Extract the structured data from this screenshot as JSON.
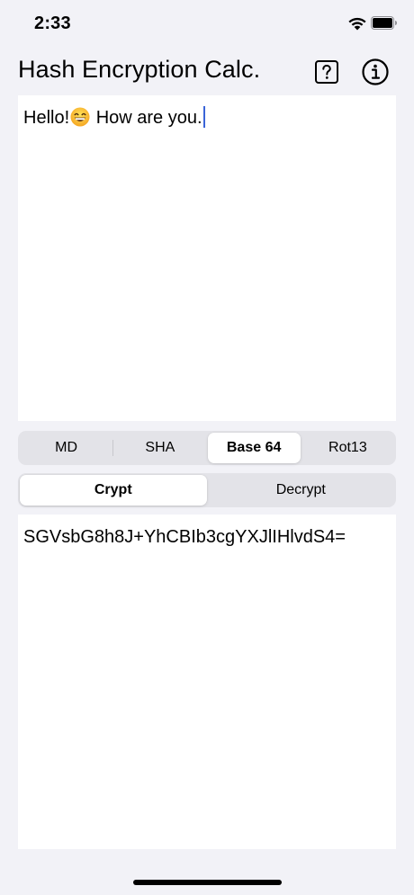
{
  "status_bar": {
    "time": "2:33",
    "icons": [
      "wifi-icon",
      "battery-icon"
    ]
  },
  "nav": {
    "title": "Hash Encryption Calc.",
    "help_icon": "question-square-icon",
    "info_icon": "info-circle-icon"
  },
  "input": {
    "text_before_emoji": "Hello!",
    "emoji": "grinning-face-emoji",
    "text_after_emoji": " How are you."
  },
  "algorithm_tabs": {
    "items": [
      {
        "label": "MD",
        "selected": false
      },
      {
        "label": "SHA",
        "selected": false
      },
      {
        "label": "Base 64",
        "selected": true
      },
      {
        "label": "Rot13",
        "selected": false
      }
    ]
  },
  "mode_tabs": {
    "items": [
      {
        "label": "Crypt",
        "selected": true
      },
      {
        "label": "Decrypt",
        "selected": false
      }
    ]
  },
  "output": {
    "text": "SGVsbG8h8J+YhCBIb3cgYXJlIHlvdS4="
  },
  "colors": {
    "background": "#f2f2f7",
    "segment_track": "#e3e3e8",
    "caret": "#3a64d8",
    "text": "#000000"
  }
}
